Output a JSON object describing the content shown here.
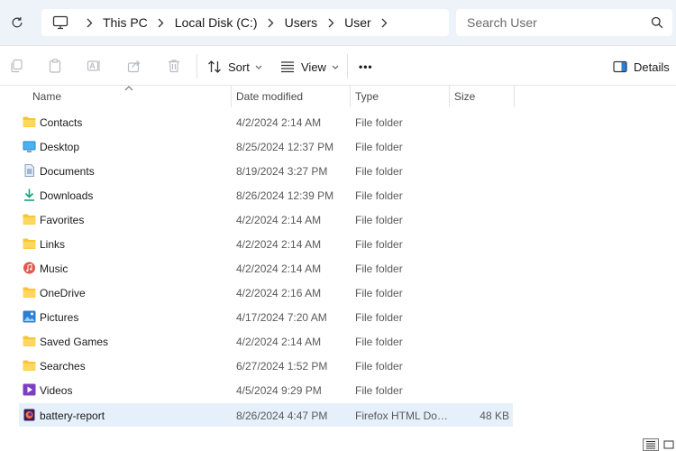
{
  "address": {
    "breadcrumbs": [
      "This PC",
      "Local Disk (C:)",
      "Users",
      "User"
    ],
    "search_placeholder": "Search User"
  },
  "toolbar": {
    "sort_label": "Sort",
    "view_label": "View",
    "more_label": "•••",
    "details_label": "Details"
  },
  "columns": {
    "name": "Name",
    "date": "Date modified",
    "type": "Type",
    "size": "Size"
  },
  "files": [
    {
      "name": "Contacts",
      "date": "4/2/2024 2:14 AM",
      "type": "File folder",
      "size": "",
      "icon": "folder-icon"
    },
    {
      "name": "Desktop",
      "date": "8/25/2024 12:37 PM",
      "type": "File folder",
      "size": "",
      "icon": "desktop-folder-icon"
    },
    {
      "name": "Documents",
      "date": "8/19/2024 3:27 PM",
      "type": "File folder",
      "size": "",
      "icon": "documents-folder-icon"
    },
    {
      "name": "Downloads",
      "date": "8/26/2024 12:39 PM",
      "type": "File folder",
      "size": "",
      "icon": "downloads-folder-icon"
    },
    {
      "name": "Favorites",
      "date": "4/2/2024 2:14 AM",
      "type": "File folder",
      "size": "",
      "icon": "folder-icon"
    },
    {
      "name": "Links",
      "date": "4/2/2024 2:14 AM",
      "type": "File folder",
      "size": "",
      "icon": "folder-icon"
    },
    {
      "name": "Music",
      "date": "4/2/2024 2:14 AM",
      "type": "File folder",
      "size": "",
      "icon": "music-folder-icon"
    },
    {
      "name": "OneDrive",
      "date": "4/2/2024 2:16 AM",
      "type": "File folder",
      "size": "",
      "icon": "folder-icon"
    },
    {
      "name": "Pictures",
      "date": "4/17/2024 7:20 AM",
      "type": "File folder",
      "size": "",
      "icon": "pictures-folder-icon"
    },
    {
      "name": "Saved Games",
      "date": "4/2/2024 2:14 AM",
      "type": "File folder",
      "size": "",
      "icon": "folder-icon"
    },
    {
      "name": "Searches",
      "date": "6/27/2024 1:52 PM",
      "type": "File folder",
      "size": "",
      "icon": "folder-icon"
    },
    {
      "name": "Videos",
      "date": "4/5/2024 9:29 PM",
      "type": "File folder",
      "size": "",
      "icon": "videos-folder-icon"
    },
    {
      "name": "battery-report",
      "date": "8/26/2024 4:47 PM",
      "type": "Firefox HTML Document",
      "size": "48 KB",
      "icon": "firefox-html-file-icon",
      "selected": true
    }
  ],
  "colors": {
    "address_bar_bg": "#eef3f9",
    "selection_bg": "#e5f0fb",
    "folder_yellow": "#f8c533",
    "accent_blue": "#2d7fd3"
  }
}
